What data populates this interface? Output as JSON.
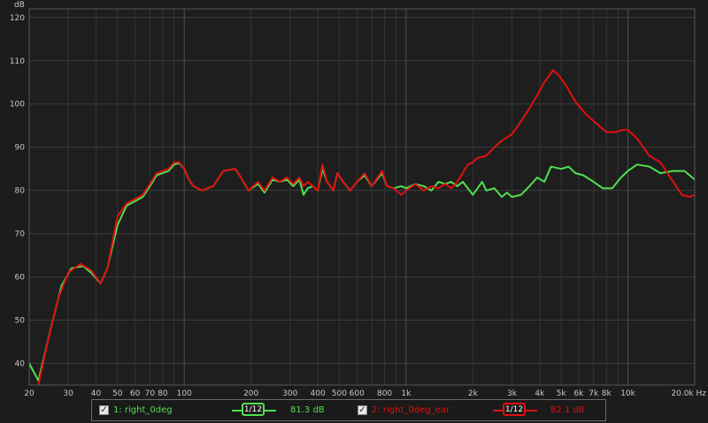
{
  "chart_data": {
    "type": "line",
    "xscale": "log",
    "ylabel": "dB",
    "xlim": [
      20,
      20000
    ],
    "ylim": [
      35,
      122
    ],
    "grid": true,
    "y_ticks": [
      "40",
      "50",
      "60",
      "70",
      "80",
      "90",
      "100",
      "110",
      "120"
    ],
    "x_ticks": [
      {
        "f": 20,
        "label": "20"
      },
      {
        "f": 30,
        "label": "30"
      },
      {
        "f": 40,
        "label": "40"
      },
      {
        "f": 50,
        "label": "50"
      },
      {
        "f": 60,
        "label": "60"
      },
      {
        "f": 70,
        "label": "70"
      },
      {
        "f": 80,
        "label": "80"
      },
      {
        "f": 100,
        "label": "100"
      },
      {
        "f": 200,
        "label": "200"
      },
      {
        "f": 300,
        "label": "300"
      },
      {
        "f": 400,
        "label": "400"
      },
      {
        "f": 500,
        "label": "500"
      },
      {
        "f": 600,
        "label": "600"
      },
      {
        "f": 800,
        "label": "800"
      },
      {
        "f": 1000,
        "label": "1k"
      },
      {
        "f": 2000,
        "label": "2k"
      },
      {
        "f": 3000,
        "label": "3k"
      },
      {
        "f": 4000,
        "label": "4k"
      },
      {
        "f": 5000,
        "label": "5k"
      },
      {
        "f": 6000,
        "label": "6k"
      },
      {
        "f": 7000,
        "label": "7k"
      },
      {
        "f": 8000,
        "label": "8k"
      },
      {
        "f": 10000,
        "label": "10k"
      },
      {
        "f": 20000,
        "label": "20.0k Hz"
      }
    ],
    "series": [
      {
        "name": "1: right_0deg",
        "color": "#50e050",
        "points": [
          [
            20,
            40
          ],
          [
            22,
            36
          ],
          [
            25,
            48
          ],
          [
            28,
            58
          ],
          [
            31,
            62
          ],
          [
            35,
            62.5
          ],
          [
            38,
            61
          ],
          [
            42,
            58.5
          ],
          [
            45,
            62
          ],
          [
            50,
            72
          ],
          [
            55,
            76.5
          ],
          [
            60,
            77.5
          ],
          [
            65,
            78.5
          ],
          [
            70,
            81
          ],
          [
            75,
            83.5
          ],
          [
            80,
            84
          ],
          [
            85,
            84.5
          ],
          [
            90,
            86
          ],
          [
            95,
            86.3
          ],
          [
            100,
            85
          ],
          [
            105,
            82.5
          ],
          [
            110,
            81
          ],
          [
            120,
            80
          ],
          [
            135,
            81
          ],
          [
            150,
            84.5
          ],
          [
            170,
            85
          ],
          [
            180,
            83
          ],
          [
            195,
            80
          ],
          [
            215,
            81.5
          ],
          [
            230,
            79.5
          ],
          [
            250,
            82.5
          ],
          [
            270,
            82
          ],
          [
            290,
            82.5
          ],
          [
            310,
            81
          ],
          [
            330,
            82.5
          ],
          [
            345,
            79
          ],
          [
            360,
            80.5
          ],
          [
            380,
            81
          ],
          [
            400,
            80
          ],
          [
            420,
            85
          ],
          [
            440,
            82
          ],
          [
            470,
            80
          ],
          [
            490,
            84
          ],
          [
            520,
            82
          ],
          [
            560,
            80
          ],
          [
            600,
            82
          ],
          [
            650,
            83.5
          ],
          [
            700,
            81
          ],
          [
            780,
            84
          ],
          [
            820,
            81
          ],
          [
            880,
            80.5
          ],
          [
            950,
            81
          ],
          [
            1000,
            80.5
          ],
          [
            1100,
            81.5
          ],
          [
            1200,
            81
          ],
          [
            1300,
            80
          ],
          [
            1400,
            82
          ],
          [
            1500,
            81.5
          ],
          [
            1600,
            82
          ],
          [
            1700,
            81
          ],
          [
            1800,
            82
          ],
          [
            1900,
            80.5
          ],
          [
            2000,
            79
          ],
          [
            2100,
            80.5
          ],
          [
            2200,
            82
          ],
          [
            2300,
            80
          ],
          [
            2500,
            80.5
          ],
          [
            2700,
            78.5
          ],
          [
            2850,
            79.5
          ],
          [
            3000,
            78.5
          ],
          [
            3300,
            79
          ],
          [
            3600,
            81
          ],
          [
            3900,
            83
          ],
          [
            4200,
            82
          ],
          [
            4500,
            85.5
          ],
          [
            5000,
            85
          ],
          [
            5400,
            85.5
          ],
          [
            5800,
            84
          ],
          [
            6300,
            83.5
          ],
          [
            7000,
            82
          ],
          [
            7700,
            80.5
          ],
          [
            8500,
            80.5
          ],
          [
            9300,
            83
          ],
          [
            10000,
            84.5
          ],
          [
            11000,
            86
          ],
          [
            12500,
            85.5
          ],
          [
            14000,
            84
          ],
          [
            16000,
            84.5
          ],
          [
            18000,
            84.5
          ],
          [
            20000,
            82.5
          ]
        ]
      },
      {
        "name": "2: right_0deg_ear",
        "color": "#e01010",
        "points": [
          [
            22,
            35
          ],
          [
            24,
            44
          ],
          [
            27,
            55
          ],
          [
            30,
            61
          ],
          [
            34,
            63
          ],
          [
            38,
            61.5
          ],
          [
            42,
            58.5
          ],
          [
            45,
            62
          ],
          [
            50,
            74
          ],
          [
            55,
            77
          ],
          [
            60,
            78
          ],
          [
            65,
            79
          ],
          [
            70,
            81.5
          ],
          [
            75,
            84
          ],
          [
            80,
            84.5
          ],
          [
            85,
            85
          ],
          [
            90,
            86.5
          ],
          [
            95,
            86.5
          ],
          [
            100,
            85
          ],
          [
            105,
            82.5
          ],
          [
            110,
            81
          ],
          [
            120,
            80
          ],
          [
            135,
            81
          ],
          [
            150,
            84.5
          ],
          [
            170,
            85
          ],
          [
            180,
            83
          ],
          [
            195,
            80
          ],
          [
            215,
            82
          ],
          [
            230,
            80
          ],
          [
            250,
            83
          ],
          [
            270,
            82
          ],
          [
            290,
            83
          ],
          [
            310,
            81.5
          ],
          [
            330,
            83
          ],
          [
            345,
            81
          ],
          [
            360,
            82
          ],
          [
            380,
            81
          ],
          [
            400,
            80
          ],
          [
            420,
            86
          ],
          [
            440,
            82
          ],
          [
            470,
            80
          ],
          [
            490,
            84
          ],
          [
            520,
            82
          ],
          [
            560,
            80
          ],
          [
            600,
            82
          ],
          [
            650,
            84
          ],
          [
            700,
            81
          ],
          [
            780,
            84.5
          ],
          [
            820,
            81
          ],
          [
            880,
            80.5
          ],
          [
            950,
            79
          ],
          [
            1000,
            80
          ],
          [
            1100,
            81.5
          ],
          [
            1200,
            80
          ],
          [
            1300,
            81
          ],
          [
            1400,
            80.5
          ],
          [
            1500,
            81.5
          ],
          [
            1600,
            80.5
          ],
          [
            1700,
            82
          ],
          [
            1800,
            84
          ],
          [
            1900,
            86
          ],
          [
            2000,
            86.5
          ],
          [
            2100,
            87.5
          ],
          [
            2300,
            88
          ],
          [
            2500,
            90
          ],
          [
            2700,
            91.5
          ],
          [
            3000,
            93
          ],
          [
            3300,
            96
          ],
          [
            3600,
            99
          ],
          [
            3900,
            102
          ],
          [
            4200,
            105
          ],
          [
            4600,
            107.8
          ],
          [
            4900,
            106.5
          ],
          [
            5300,
            104
          ],
          [
            5800,
            100.5
          ],
          [
            6500,
            97.5
          ],
          [
            7200,
            95.5
          ],
          [
            8000,
            93.5
          ],
          [
            8800,
            93.5
          ],
          [
            9500,
            94
          ],
          [
            10000,
            94
          ],
          [
            11000,
            92
          ],
          [
            12500,
            88
          ],
          [
            14000,
            86.5
          ],
          [
            16000,
            82
          ],
          [
            17500,
            79
          ],
          [
            19000,
            78.5
          ],
          [
            20000,
            79
          ]
        ]
      }
    ]
  },
  "legend": {
    "series1": {
      "label": "1: right_0deg",
      "smoothing": "1/12",
      "level": "81.3 dB"
    },
    "series2": {
      "label": "2: right_0deg_ear",
      "smoothing": "1/12",
      "level": "82.1 dB"
    },
    "checkbox_symbol": "✓"
  }
}
